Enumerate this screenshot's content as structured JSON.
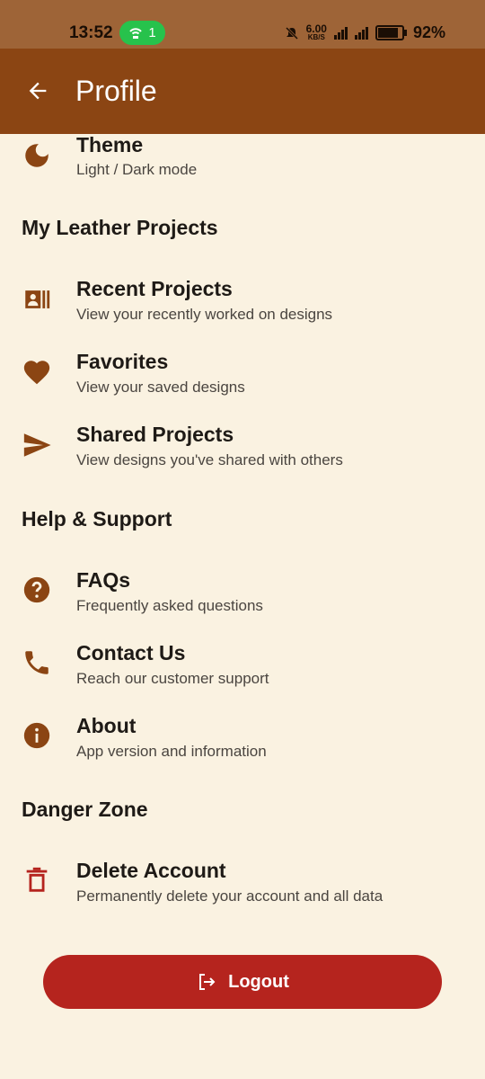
{
  "status": {
    "time": "13:52",
    "hotspot_count": "1",
    "net_speed": "6.00",
    "net_unit": "KB/S",
    "battery": "92%",
    "battery_level": 0.92
  },
  "appbar": {
    "title": "Profile"
  },
  "items": {
    "theme": {
      "title": "Theme",
      "subtitle": "Light / Dark mode"
    },
    "recent": {
      "title": "Recent Projects",
      "subtitle": "View your recently worked on designs"
    },
    "favorites": {
      "title": "Favorites",
      "subtitle": "View your saved designs"
    },
    "shared": {
      "title": "Shared Projects",
      "subtitle": "View designs you've shared with others"
    },
    "faqs": {
      "title": "FAQs",
      "subtitle": "Frequently asked questions"
    },
    "contact": {
      "title": "Contact Us",
      "subtitle": "Reach our customer support"
    },
    "about": {
      "title": "About",
      "subtitle": "App version and information"
    },
    "delete": {
      "title": "Delete Account",
      "subtitle": "Permanently delete your account and all data"
    }
  },
  "sections": {
    "projects": "My Leather Projects",
    "support": "Help & Support",
    "danger": "Danger Zone"
  },
  "logout_label": "Logout",
  "colors": {
    "appbar": "#8b4513",
    "background": "#faf2e1",
    "icon": "#8b4513",
    "danger": "#b5241e"
  }
}
